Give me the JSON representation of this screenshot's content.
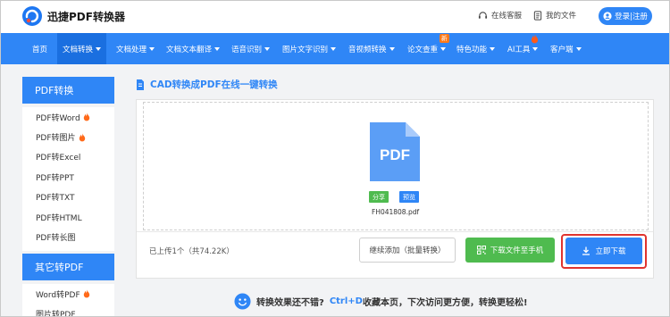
{
  "header": {
    "brand": "迅捷PDF转换器",
    "support_label": "在线客服",
    "files_label": "我的文件",
    "login_label": "登录|注册"
  },
  "nav": {
    "items": [
      {
        "label": "首页"
      },
      {
        "label": "文档转换"
      },
      {
        "label": "文档处理"
      },
      {
        "label": "文档文本翻译"
      },
      {
        "label": "语音识别"
      },
      {
        "label": "图片文字识别"
      },
      {
        "label": "音视频转换"
      },
      {
        "label": "论文查重"
      },
      {
        "label": "特色功能"
      },
      {
        "label": "AI工具"
      },
      {
        "label": "客户端"
      }
    ],
    "new_badge": "新"
  },
  "sidebar": {
    "section1_title": "PDF转换",
    "section1_items": [
      {
        "label": "PDF转Word",
        "hot": true
      },
      {
        "label": "PDF转图片",
        "hot": true
      },
      {
        "label": "PDF转Excel",
        "hot": false
      },
      {
        "label": "PDF转PPT",
        "hot": false
      },
      {
        "label": "PDF转TXT",
        "hot": false
      },
      {
        "label": "PDF转HTML",
        "hot": false
      },
      {
        "label": "PDF转长图",
        "hot": false
      }
    ],
    "section2_title": "其它转PDF",
    "section2_items": [
      {
        "label": "Word转PDF",
        "hot": true
      },
      {
        "label": "图片转PDF",
        "hot": false
      }
    ]
  },
  "main": {
    "title": "CAD转换成PDF在线一键转换",
    "file": {
      "icon_text": "PDF",
      "share_label": "分享",
      "preview_label": "预览",
      "name": "FH041808.pdf"
    },
    "upload_status": "已上传1个（共74.22K）",
    "add_button": "继续添加（批量转换）",
    "phone_button": "下载文件至手机",
    "download_button": "立即下载"
  },
  "promo": {
    "text1": "转换效果还不错?",
    "shortcut": "Ctrl+D",
    "text2": "收藏本页，下次访问更方便，转换更轻松!"
  },
  "colors": {
    "accent": "#2f86f6",
    "green": "#4fbb4f",
    "highlight_ring": "#e0342f",
    "hot": "#ff6a1a"
  }
}
